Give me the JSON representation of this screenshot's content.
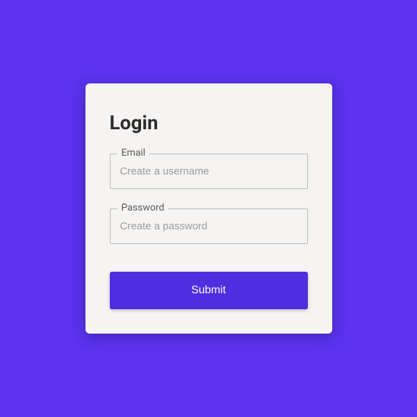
{
  "form": {
    "title": "Login",
    "fields": {
      "email": {
        "label": "Email",
        "placeholder": "Create a username",
        "value": ""
      },
      "password": {
        "label": "Password",
        "placeholder": "Create a password",
        "value": ""
      }
    },
    "submit_label": "Submit"
  }
}
